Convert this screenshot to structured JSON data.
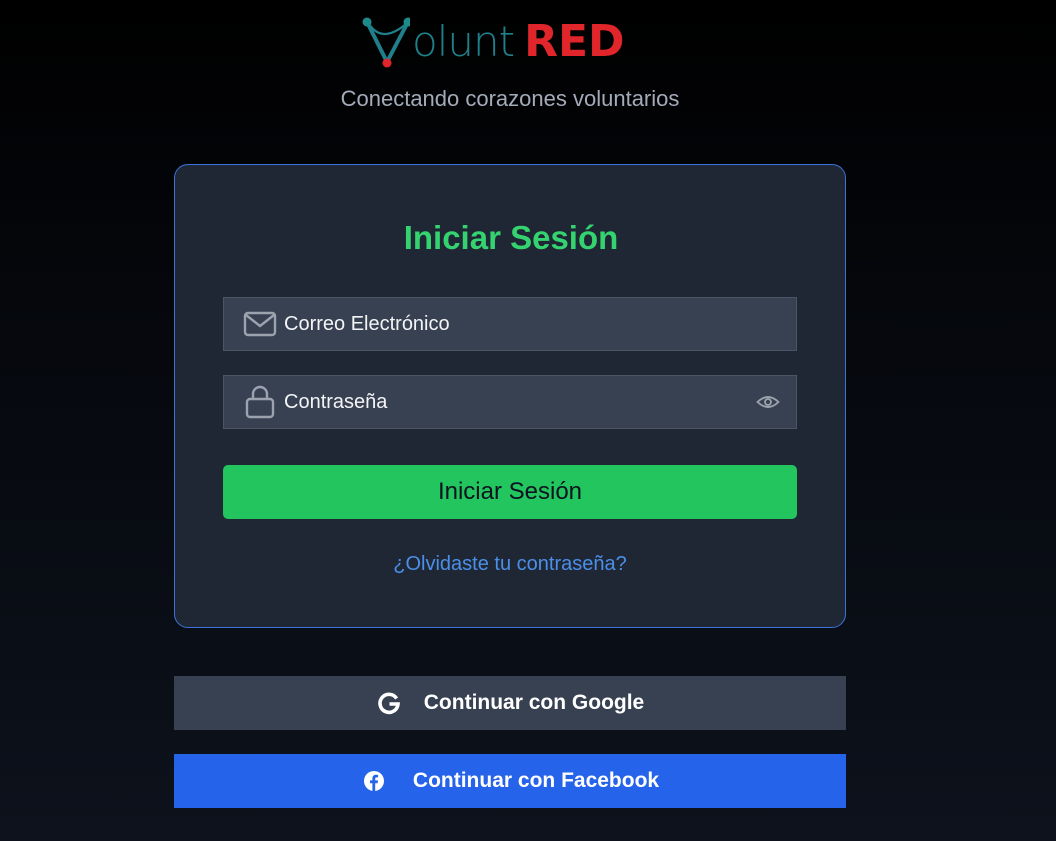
{
  "brand": {
    "logo_part1": "olunt",
    "logo_part2": "RED",
    "tagline": "Conectando corazones voluntarios",
    "colors": {
      "teal": "#1f7f8a",
      "red": "#e0262b"
    }
  },
  "login": {
    "title": "Iniciar Sesión",
    "email": {
      "placeholder": "Correo Electrónico",
      "value": "",
      "icon": "mail-icon"
    },
    "password": {
      "placeholder": "Contraseña",
      "value": "",
      "icon": "lock-icon",
      "toggle_icon": "eye-icon"
    },
    "submit_label": "Iniciar Sesión",
    "forgot_label": "¿Olvidaste tu contraseña?"
  },
  "social": {
    "google_label": "Continuar con Google",
    "facebook_label": "Continuar con Facebook"
  },
  "colors": {
    "accent_green": "#22c55e",
    "title_green": "#34d36f",
    "link_blue": "#4b8fe8",
    "facebook_blue": "#2563eb",
    "card_border": "#3b73d9"
  }
}
